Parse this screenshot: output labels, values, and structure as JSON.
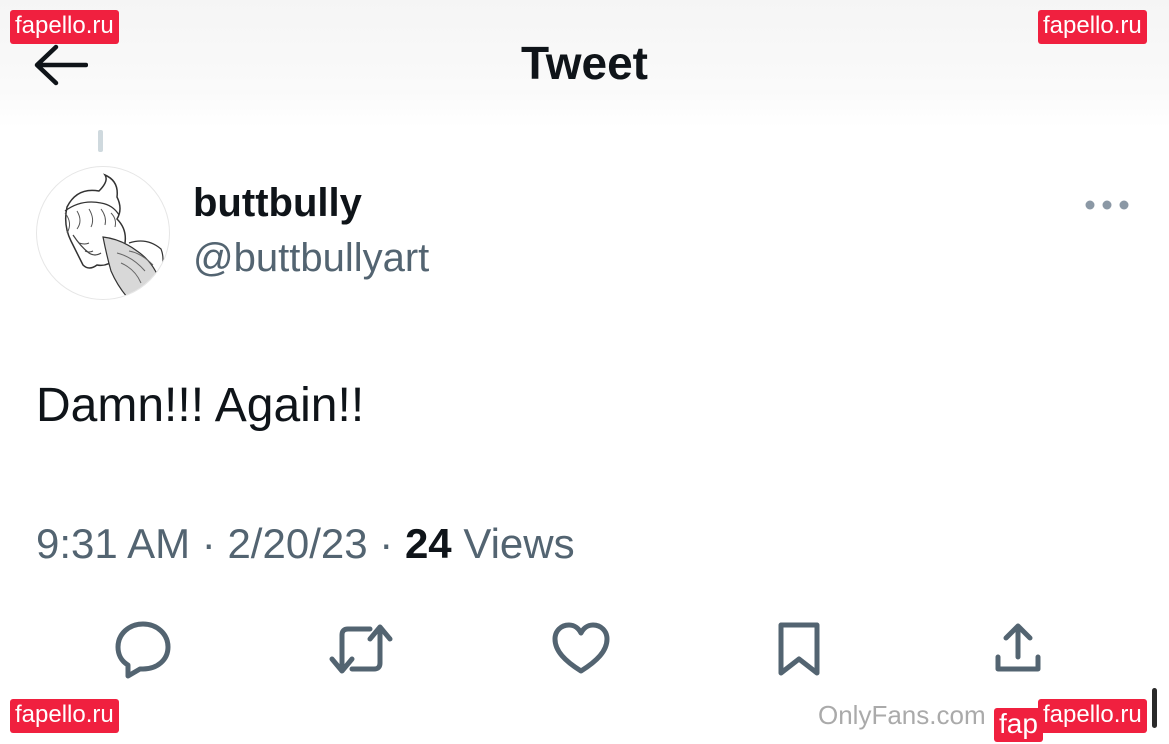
{
  "header": {
    "title": "Tweet"
  },
  "tweet": {
    "display_name": "buttbully",
    "handle": "@buttbullyart",
    "text": "Damn!!! Again!!",
    "time": "9:31 AM",
    "separator": "·",
    "date": "2/20/23",
    "views_count": "24",
    "views_label": "Views"
  },
  "icons": {
    "back": "arrow-left-icon",
    "more": "more-horizontal-icon",
    "reply": "reply-icon",
    "retweet": "retweet-icon",
    "like": "heart-icon",
    "bookmark": "bookmark-icon",
    "share": "share-icon"
  },
  "watermarks": {
    "brand": "fapello.ru",
    "brand_partial": "fap",
    "onlyfans": "OnlyFans.com"
  },
  "colors": {
    "text_primary": "#0f1419",
    "text_secondary": "#536471",
    "icon": "#536471",
    "watermark_bg": "#f0203f"
  }
}
